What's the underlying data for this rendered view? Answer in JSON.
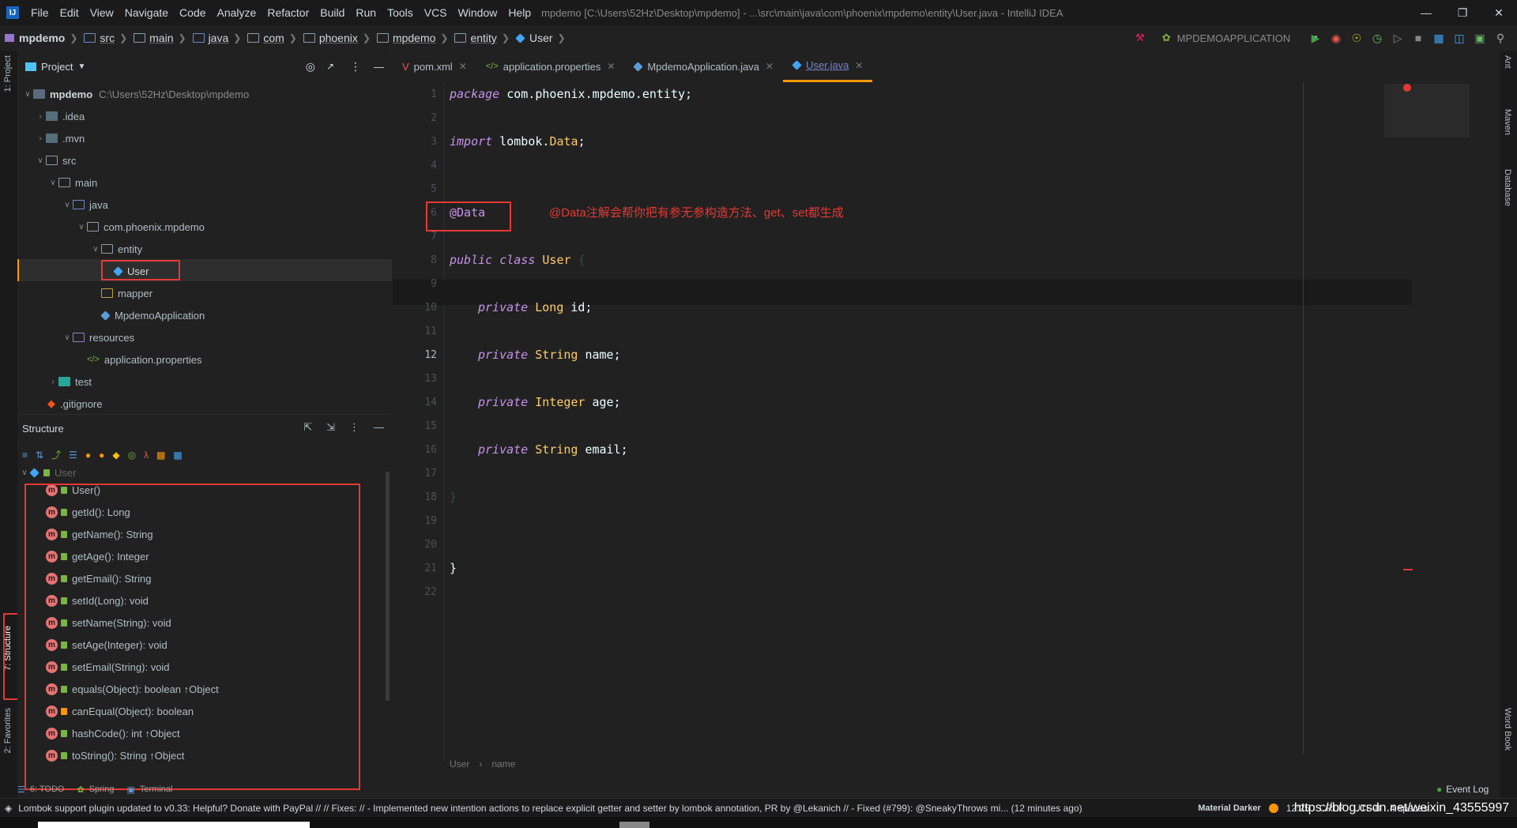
{
  "window": {
    "title": "mpdemo [C:\\Users\\52Hz\\Desktop\\mpdemo] - ...\\src\\main\\java\\com\\phoenix\\mpdemo\\entity\\User.java - IntelliJ IDEA",
    "menu": [
      "File",
      "Edit",
      "View",
      "Navigate",
      "Code",
      "Analyze",
      "Refactor",
      "Build",
      "Run",
      "Tools",
      "VCS",
      "Window",
      "Help"
    ]
  },
  "breadcrumb": [
    "mpdemo",
    "src",
    "main",
    "java",
    "com",
    "phoenix",
    "mpdemo",
    "entity",
    "User"
  ],
  "run_config": "MPDEMOAPPLICATION",
  "project": {
    "header": "Project",
    "root_name": "mpdemo",
    "root_path": "C:\\Users\\52Hz\\Desktop\\mpdemo",
    "items": [
      ".idea",
      ".mvn",
      "src",
      "main",
      "java",
      "com.phoenix.mpdemo",
      "entity",
      "User",
      "mapper",
      "MpdemoApplication",
      "resources",
      "application.properties",
      "test",
      ".gitignore"
    ]
  },
  "structure": {
    "header": "Structure",
    "root": "User",
    "members": [
      "User()",
      "getId(): Long",
      "getName(): String",
      "getAge(): Integer",
      "getEmail(): String",
      "setId(Long): void",
      "setName(String): void",
      "setAge(Integer): void",
      "setEmail(String): void",
      "equals(Object): boolean ↑Object",
      "canEqual(Object): boolean",
      "hashCode(): int ↑Object",
      "toString(): String ↑Object"
    ]
  },
  "tabs": [
    "pom.xml",
    "application.properties",
    "MpdemoApplication.java",
    "User.java"
  ],
  "editor": {
    "line_numbers": [
      "1",
      "2",
      "3",
      "4",
      "5",
      "6",
      "7",
      "8",
      "9",
      "10",
      "11",
      "12",
      "13",
      "14",
      "15",
      "16",
      "17",
      "18",
      "19",
      "20",
      "21",
      "22"
    ],
    "l1_kw": "package",
    "l1_rest": " com.phoenix.mpdemo.entity;",
    "l3_kw": "import",
    "l3_a": " lombok.",
    "l3_b": "Data",
    "l3_c": ";",
    "l6": "@Data",
    "annotation_note": "@Data注解会帮你把有参无参构造方法、get、set都生成",
    "l8_kw1": "public",
    "l8_kw2": "class",
    "l8_name": "User",
    "l8_br": "{",
    "fields": [
      {
        "kw": "private",
        "type": "Long",
        "name": " id;"
      },
      {
        "kw": "private",
        "type": "String",
        "name": " name;"
      },
      {
        "kw": "private",
        "type": "Integer",
        "name": " age;"
      },
      {
        "kw": "private",
        "type": "String",
        "name": " email;"
      }
    ],
    "l18": "}",
    "l21": "}",
    "breadcrumb_bottom": [
      "User",
      "name"
    ]
  },
  "left_stripe": [
    "1: Project",
    "7: Structure",
    "2: Favorites"
  ],
  "right_stripe": [
    "Ant",
    "Maven",
    "Database",
    "Word Book"
  ],
  "bottom_tabs": [
    "6: TODO",
    "Spring",
    "Terminal"
  ],
  "event_log": "Event Log",
  "status": {
    "message": "Lombok support plugin updated to v0.33: Helpful? Donate with PayPal // // Fixes: // - Implemented new intention actions to replace explicit getter and setter by lombok annotation, PR by @Lekanich // - Fixed (#799): @SneakyThrows mi... (12 minutes ago)",
    "theme": "Material Darker",
    "position": "12:25",
    "line_sep": "CRLF",
    "encoding": "UTF-8",
    "indent": "4 spaces",
    "watermark": "https://blog.csdn.net/weixin_43555997"
  },
  "colors": {
    "accent": "#ff9800",
    "keyword": "#c792ea",
    "type": "#ffcb6b",
    "annotation_red": "#e53935"
  }
}
